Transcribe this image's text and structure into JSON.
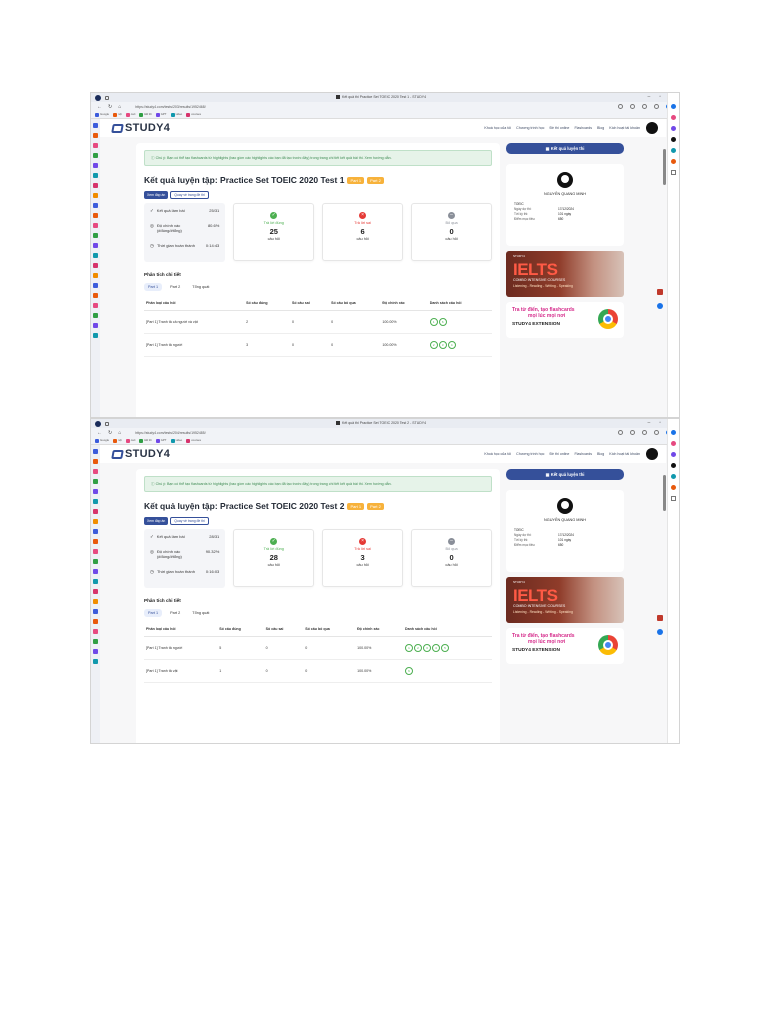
{
  "screenshots": [
    {
      "browser": {
        "title": "Kết quả thi Practice Set TOEIC 2020 Test 1 - STUDY4",
        "url": "https://study4.com/tests/203/results/1952468/"
      },
      "site": {
        "logo": "STUDY4",
        "nav": [
          "Khoá học của tôi",
          "Chương trình học",
          "Đề thi online",
          "Flashcards",
          "Blog",
          "Kích hoạt tài khoản"
        ]
      },
      "alert": "Chú ý: Bạn có thể tạo flashcards từ highlights (bao gồm các highlights các bạn đã tạo trước đây) trong trang chi tiết kết quả bài thi. Xem hướng dẫn.",
      "title": "Kết quả luyện tập: Practice Set TOEIC 2020 Test 1",
      "title_badges": [
        "Part 1",
        "Part 2"
      ],
      "buttons": {
        "view_answers": "Xem đáp án",
        "back": "Quay về trang đề thi"
      },
      "summary": {
        "result_label": "Kết quả làm bài",
        "result_value": "25/31",
        "accuracy_label": "Độ chính xác (#đúng/#tổng)",
        "accuracy_value": "80.6%",
        "time_label": "Thời gian hoàn thành",
        "time_value": "0:14:43"
      },
      "stats": [
        {
          "label": "Trả lời đúng",
          "value": "25",
          "unit": "câu hỏi",
          "color": "#4caf50",
          "icon": "check-icon"
        },
        {
          "label": "Trả lời sai",
          "value": "6",
          "unit": "câu hỏi",
          "color": "#e53935",
          "icon": "x-icon"
        },
        {
          "label": "Bỏ qua",
          "value": "0",
          "unit": "câu hỏi",
          "color": "#8a8f99",
          "icon": "minus-icon"
        }
      ],
      "section": "Phân tích chi tiết",
      "tabs": [
        "Part 1",
        "Part 2",
        "Tổng quát"
      ],
      "table": {
        "headers": [
          "Phân loại câu hỏi",
          "Số câu đúng",
          "Số câu sai",
          "Số câu bỏ qua",
          "Độ chính xác",
          "Danh sách câu hỏi"
        ],
        "rows": [
          {
            "cat": "[Part 1] Tranh tả cả người và vật",
            "correct": "2",
            "wrong": "0",
            "skip": "0",
            "acc": "100.00%",
            "qs": [
              "1",
              "6"
            ]
          },
          {
            "cat": "[Part 1] Tranh tả người",
            "correct": "3",
            "wrong": "0",
            "skip": "0",
            "acc": "100.00%",
            "qs": [
              "2",
              "3",
              "4"
            ]
          }
        ]
      },
      "sidebar": {
        "button": "Kết quả luyện thi",
        "name": "NGUYỄN QUANG MINH",
        "target_label": "TOEIC",
        "info": [
          {
            "k": "Ngày dự thi:",
            "v": "17/12/2024"
          },
          {
            "k": "Tới kỳ thi:",
            "v": "101 ngày"
          },
          {
            "k": "Điểm mục tiêu:",
            "v": "650"
          }
        ],
        "ad": {
          "brand": "STUDY4",
          "big": "IELTS",
          "line1": "COMBO INTENSIVE COURSES",
          "line2": "Listening - Reading - Writing - Speaking"
        },
        "ext": {
          "l1": "Tra từ điển, tạo flashcards",
          "l2": "mọi lúc mọi nơi",
          "l3": "STUDY4 EXTENSION"
        }
      }
    },
    {
      "browser": {
        "title": "Kết quả thi Practice Set TOEIC 2020 Test 2 - STUDY4",
        "url": "https://study4.com/tests/204/results/1952485/"
      },
      "site": {
        "logo": "STUDY4",
        "nav": [
          "Khoá học của tôi",
          "Chương trình học",
          "Đề thi online",
          "Flashcards",
          "Blog",
          "Kích hoạt tài khoản"
        ]
      },
      "alert": "Chú ý: Bạn có thể tạo flashcards từ highlights (bao gồm các highlights các bạn đã tạo trước đây) trong trang chi tiết kết quả bài thi. Xem hướng dẫn.",
      "title": "Kết quả luyện tập: Practice Set TOEIC 2020 Test 2",
      "title_badges": [
        "Part 1",
        "Part 2"
      ],
      "buttons": {
        "view_answers": "Xem đáp án",
        "back": "Quay về trang đề thi"
      },
      "summary": {
        "result_label": "Kết quả làm bài",
        "result_value": "28/31",
        "accuracy_label": "Độ chính xác (#đúng/#tổng)",
        "accuracy_value": "90.32%",
        "time_label": "Thời gian hoàn thành",
        "time_value": "0:16:03"
      },
      "stats": [
        {
          "label": "Trả lời đúng",
          "value": "28",
          "unit": "câu hỏi",
          "color": "#4caf50",
          "icon": "check-icon"
        },
        {
          "label": "Trả lời sai",
          "value": "3",
          "unit": "câu hỏi",
          "color": "#e53935",
          "icon": "x-icon"
        },
        {
          "label": "Bỏ qua",
          "value": "0",
          "unit": "câu hỏi",
          "color": "#8a8f99",
          "icon": "minus-icon"
        }
      ],
      "section": "Phân tích chi tiết",
      "tabs": [
        "Part 1",
        "Part 2",
        "Tổng quát"
      ],
      "table": {
        "headers": [
          "Phân loại câu hỏi",
          "Số câu đúng",
          "Số câu sai",
          "Số câu bỏ qua",
          "Độ chính xác",
          "Danh sách câu hỏi"
        ],
        "rows": [
          {
            "cat": "[Part 1] Tranh tả người",
            "correct": "5",
            "wrong": "0",
            "skip": "0",
            "acc": "100.00%",
            "qs": [
              "1",
              "2",
              "3",
              "4",
              "5"
            ]
          },
          {
            "cat": "[Part 1] Tranh tả vật",
            "correct": "1",
            "wrong": "0",
            "skip": "0",
            "acc": "100.00%",
            "qs": [
              "6"
            ]
          }
        ]
      },
      "sidebar": {
        "button": "Kết quả luyện thi",
        "name": "NGUYỄN QUANG MINH",
        "target_label": "TOEIC",
        "info": [
          {
            "k": "Ngày dự thi:",
            "v": "17/12/2024"
          },
          {
            "k": "Tới kỳ thi:",
            "v": "101 ngày"
          },
          {
            "k": "Điểm mục tiêu:",
            "v": "650"
          }
        ],
        "ad": {
          "brand": "STUDY4",
          "big": "IELTS",
          "line1": "COMBO INTENSIVE COURSES",
          "line2": "Listening - Reading - Writing - Speaking"
        },
        "ext": {
          "l1": "Tra từ điển, tạo flashcards",
          "l2": "mọi lúc mọi nơi",
          "l3": "STUDY4 EXTENSION"
        }
      }
    }
  ],
  "bookmarks": [
    "Google",
    "nội",
    "cart",
    "Đề thi",
    "GPT",
    "video",
    "courses"
  ],
  "rail_colors": [
    "#3b5bdb",
    "#e8590c",
    "#e64980",
    "#2f9e44",
    "#7048e8",
    "#1098ad",
    "#d6336c",
    "#f08c00"
  ]
}
